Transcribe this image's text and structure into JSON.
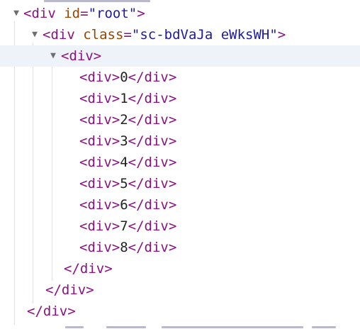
{
  "colors": {
    "tag": "#881280",
    "attribute_name": "#994500",
    "attribute_value": "#1a1aa6",
    "text_node": "#222222",
    "selected_row_bg": "#eef3fa",
    "guide_line": "#dfe3e8",
    "arrow": "#6e6e6e"
  },
  "icons": {
    "expanded": "triangle-down-icon"
  },
  "tree": {
    "root_open": {
      "arrow": "▼",
      "open": "<div",
      "attr": "id",
      "eq": "=",
      "value": "\"root\"",
      "close": ">"
    },
    "styled_open": {
      "arrow": "▼",
      "open": "<div",
      "attr": "class",
      "eq": "=",
      "value": "\"sc-bdVaJa eWksWH\"",
      "close": ">"
    },
    "inner_open": {
      "arrow": "▼",
      "tag": "<div>"
    },
    "children": [
      {
        "open": "<div>",
        "text": "0",
        "close": "</div>"
      },
      {
        "open": "<div>",
        "text": "1",
        "close": "</div>"
      },
      {
        "open": "<div>",
        "text": "2",
        "close": "</div>"
      },
      {
        "open": "<div>",
        "text": "3",
        "close": "</div>"
      },
      {
        "open": "<div>",
        "text": "4",
        "close": "</div>"
      },
      {
        "open": "<div>",
        "text": "5",
        "close": "</div>"
      },
      {
        "open": "<div>",
        "text": "6",
        "close": "</div>"
      },
      {
        "open": "<div>",
        "text": "7",
        "close": "</div>"
      },
      {
        "open": "<div>",
        "text": "8",
        "close": "</div>"
      }
    ],
    "inner_close": "</div>",
    "styled_close": "</div>",
    "root_close": "</div>"
  }
}
